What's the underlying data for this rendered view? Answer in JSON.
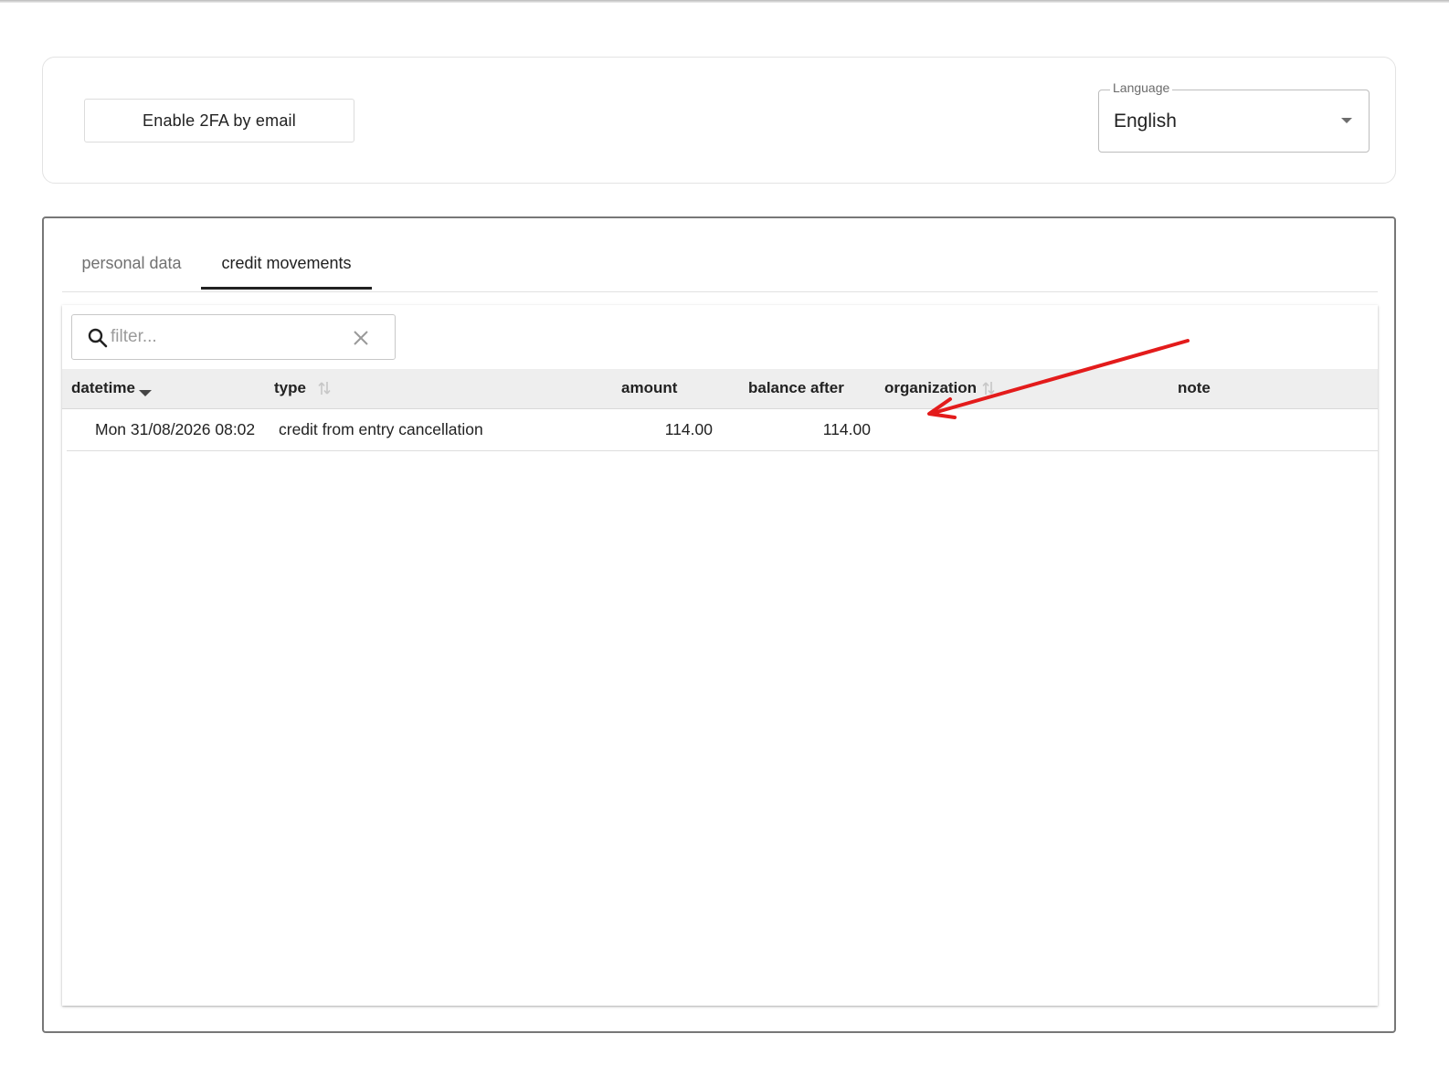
{
  "settings": {
    "twofa_button_label": "Enable 2FA by email",
    "language": {
      "label": "Language",
      "selected": "English"
    }
  },
  "tabs": [
    {
      "label": "personal data",
      "active": false
    },
    {
      "label": "credit movements",
      "active": true
    }
  ],
  "filter": {
    "placeholder": "filter...",
    "value": ""
  },
  "table": {
    "columns": [
      {
        "label": "datetime",
        "sort": "desc"
      },
      {
        "label": "type",
        "sort": "sortable"
      },
      {
        "label": "amount",
        "sort": "none"
      },
      {
        "label": "balance after",
        "sort": "none"
      },
      {
        "label": "organization",
        "sort": "sortable"
      },
      {
        "label": "note",
        "sort": "none"
      }
    ],
    "rows": [
      {
        "datetime": "Mon 31/08/2026 08:02",
        "type": "credit from entry cancellation",
        "amount": "114.00",
        "balance_after": "114.00",
        "organization": "",
        "note": ""
      }
    ]
  },
  "colors": {
    "annotation_arrow": "#e31b1b",
    "active_tab_underline": "#212121",
    "header_background": "#eeeeee"
  },
  "icons": {
    "search": "search-icon",
    "clear": "close-icon",
    "dropdown": "caret-down-icon",
    "sort": "sort-icon"
  }
}
